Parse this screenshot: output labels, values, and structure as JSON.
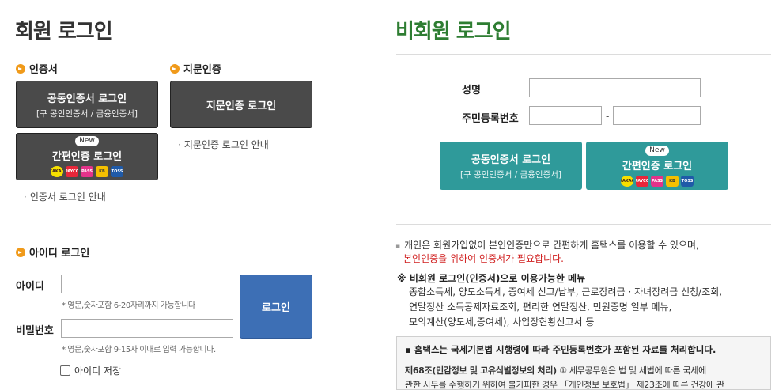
{
  "member": {
    "title": "회원 로그인",
    "cert_section": "인증서",
    "finger_section": "지문인증",
    "joint_cert_btn": {
      "line1": "공동인증서 로그인",
      "line2": "[구 공인인증서 / 금융인증서]"
    },
    "simple_cert_btn": {
      "badge": "New",
      "line1": "간편인증 로그인",
      "icons": [
        "KAKAO",
        "PAYCO",
        "PASS",
        "KB",
        "TOSS"
      ]
    },
    "finger_btn": "지문인증 로그인",
    "finger_link": "지문인증 로그인 안내",
    "cert_link": "인증서 로그인 안내",
    "id_section": "아이디 로그인",
    "id_label": "아이디",
    "id_hint": "* 영문,숫자포함 6-20자리까지 가능합니다",
    "pw_label": "비밀번호",
    "pw_hint": "* 영문,숫자포함 9-15자 이내로 입력 가능합니다.",
    "login_btn": "로그인",
    "save_id": "아이디 저장",
    "id_value": "",
    "pw_value": ""
  },
  "guest": {
    "title": "비회원 로그인",
    "name_label": "성명",
    "rrn_label": "주민등록번호",
    "rrn_dash": "-",
    "name_value": "",
    "rrn_front": "",
    "rrn_back": "",
    "joint_cert_btn": {
      "line1": "공동인증서 로그인",
      "line2": "[구 공인인증서 / 금융인증서]"
    },
    "simple_cert_btn": {
      "badge": "New",
      "line1": "간편인증 로그인",
      "icons": [
        "KAKAO",
        "PAYCO",
        "PASS",
        "KB",
        "TOSS"
      ]
    },
    "notice1": "개인은 회원가입없이 본인인증만으로 간편하게 홈택스를 이용할 수 있으며,",
    "notice2": "본인인증을 위하여 인증서가 필요합니다.",
    "menu_title": "※ 비회원 로그인(인증서)으로 이용가능한 메뉴",
    "menu_line1": "종합소득세, 양도소득세, 증여세 신고/납부, 근로장려금 · 자녀장려금 신청/조회,",
    "menu_line2": "연말정산 소득공제자료조회, 편리한 연말정산, 민원증명 일부 메뉴,",
    "menu_line3": "모의계산(양도세,증여세), 사업장현황신고서 등",
    "box_title": "▪ 홈택스는 국세기본법 시행령에 따라 주민등록번호가 포함된 자료를 처리합니다.",
    "box_article": "제68조(민감정보 및 고유식별정보의 처리)",
    "box_text1": "① 세무공무원은 법 및 세법에 따른 국세에",
    "box_text2": "관한 사무를 수행하기 위하여 불가피한 경우 「개인정보 보호법」 제23조에 따른 건강에 관"
  },
  "colors": {
    "accent_orange": "#f09a1a",
    "guest_title": "#2e7d32",
    "teal_button": "#2f9a9a",
    "login_blue": "#3d6fb5",
    "notice_red": "#d02020"
  }
}
